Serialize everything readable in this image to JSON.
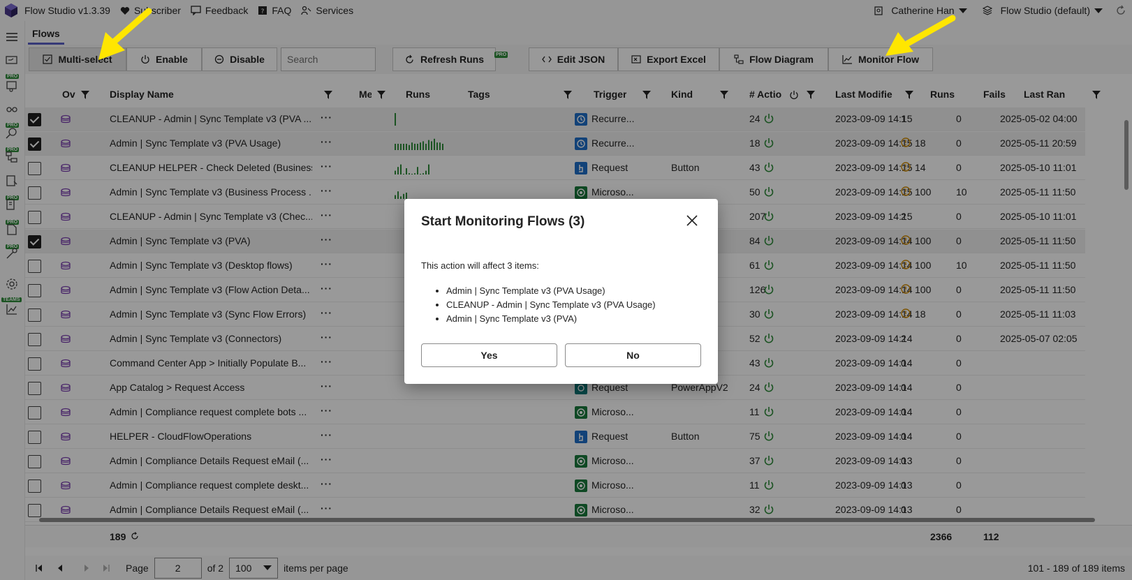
{
  "topbar": {
    "app_name": "Flow Studio v1.3.39",
    "links": [
      "Subscriber",
      "Feedback",
      "FAQ",
      "Services"
    ],
    "user": "Catherine Han",
    "environment": "Flow Studio (default)"
  },
  "tabs": [
    "Flows"
  ],
  "toolbar": {
    "multiselect": "Multi-select",
    "enable": "Enable",
    "disable": "Disable",
    "search_placeholder": "Search",
    "refresh": "Refresh Runs",
    "pro": "PRO",
    "edit_json": "Edit JSON",
    "export_excel": "Export Excel",
    "flow_diagram": "Flow Diagram",
    "monitor_flow": "Monitor Flow"
  },
  "rail": {
    "pro": "PRO",
    "teams": "TEAMS"
  },
  "columns": {
    "ov": "Ov",
    "display_name": "Display Name",
    "me": "Me",
    "runs": "Runs",
    "tags": "Tags",
    "trigger": "Trigger",
    "kind": "Kind",
    "actions": "# Actio",
    "last_modified": "Last Modifie",
    "runs2": "Runs",
    "fails": "Fails",
    "last_ran": "Last Ran"
  },
  "rows": [
    {
      "selected": true,
      "name": "CLEANUP - Admin | Sync Template v3 (PVA ...",
      "trigger": "Recurre...",
      "trigger_kind": "recurrence",
      "kind": "",
      "actions": "24",
      "modified": "2023-09-09 14:15",
      "runs": "1",
      "warn": false,
      "fails": "0",
      "last_ran": "2025-05-02 04:00",
      "spark": [
        1
      ]
    },
    {
      "selected": true,
      "name": "Admin | Sync Template v3 (PVA Usage)",
      "trigger": "Recurre...",
      "trigger_kind": "recurrence",
      "kind": "",
      "actions": "18",
      "modified": "2023-09-09 14:15",
      "runs": "18",
      "warn": true,
      "fails": "0",
      "last_ran": "2025-05-11 20:59",
      "spark": [
        0.5,
        0.5,
        0.5,
        0.5,
        0.5,
        0.4,
        0.6,
        0.5,
        0.5,
        0.6,
        0.7,
        0.5,
        0.8,
        0.7,
        0.9,
        0.6,
        0.6,
        0.5
      ]
    },
    {
      "selected": false,
      "name": "CLEANUP HELPER - Check Deleted (Business...",
      "trigger": "Request",
      "trigger_kind": "request",
      "kind": "Button",
      "actions": "43",
      "modified": "2023-09-09 14:15",
      "runs": "14",
      "warn": true,
      "fails": "0",
      "last_ran": "2025-05-10 11:01",
      "spark": [
        0.3,
        0.6,
        0.8,
        0,
        0.5,
        0.1,
        0,
        0.1,
        0.6,
        0,
        0.1,
        0.3,
        0.8
      ]
    },
    {
      "selected": false,
      "name": "Admin | Sync Template v3 (Business Process ...",
      "trigger": "Microso...",
      "trigger_kind": "microsoft",
      "kind": "",
      "actions": "50",
      "modified": "2023-09-09 14:15",
      "runs": "100",
      "warn": true,
      "fails": "10",
      "last_ran": "2025-05-11 11:50",
      "spark": [
        0.3,
        0.6,
        0.2,
        0.4,
        0.5
      ]
    },
    {
      "selected": false,
      "name": "CLEANUP - Admin | Sync Template v3 (Chec...",
      "trigger": "",
      "trigger_kind": "",
      "kind": "",
      "actions": "207",
      "modified": "2023-09-09 14:15",
      "runs": "2",
      "warn": false,
      "fails": "0",
      "last_ran": "2025-05-10 11:01",
      "spark": []
    },
    {
      "selected": true,
      "name": "Admin | Sync Template v3 (PVA)",
      "trigger": "",
      "trigger_kind": "",
      "kind": "",
      "actions": "84",
      "modified": "2023-09-09 14:14",
      "runs": "100",
      "warn": true,
      "fails": "0",
      "last_ran": "2025-05-11 11:50",
      "spark": []
    },
    {
      "selected": false,
      "name": "Admin | Sync Template v3 (Desktop flows)",
      "trigger": "",
      "trigger_kind": "",
      "kind": "",
      "actions": "61",
      "modified": "2023-09-09 14:14",
      "runs": "100",
      "warn": true,
      "fails": "10",
      "last_ran": "2025-05-11 11:50",
      "spark": []
    },
    {
      "selected": false,
      "name": "Admin | Sync Template v3 (Flow Action Deta...",
      "trigger": "",
      "trigger_kind": "",
      "kind": "",
      "actions": "126",
      "modified": "2023-09-09 14:14",
      "runs": "100",
      "warn": true,
      "fails": "0",
      "last_ran": "2025-05-11 11:50",
      "spark": []
    },
    {
      "selected": false,
      "name": "Admin | Sync Template v3 (Sync Flow Errors)",
      "trigger": "",
      "trigger_kind": "",
      "kind": "",
      "actions": "30",
      "modified": "2023-09-09 14:14",
      "runs": "18",
      "warn": true,
      "fails": "0",
      "last_ran": "2025-05-11 11:03",
      "spark": []
    },
    {
      "selected": false,
      "name": "Admin | Sync Template v3 (Connectors)",
      "trigger": "",
      "trigger_kind": "",
      "kind": "V2",
      "actions": "52",
      "modified": "2023-09-09 14:14",
      "runs": "2",
      "warn": false,
      "fails": "0",
      "last_ran": "2025-05-07 02:05",
      "spark": []
    },
    {
      "selected": false,
      "name": "Command Center App > Initially Populate B...",
      "trigger": "",
      "trigger_kind": "",
      "kind": "",
      "actions": "43",
      "modified": "2023-09-09 14:14",
      "runs": "0",
      "warn": false,
      "fails": "0",
      "last_ran": "",
      "spark": []
    },
    {
      "selected": false,
      "name": "App Catalog > Request Access",
      "trigger": "Request",
      "trigger_kind": "request-teal",
      "kind": "PowerAppV2",
      "actions": "24",
      "modified": "2023-09-09 14:14",
      "runs": "0",
      "warn": false,
      "fails": "0",
      "last_ran": "",
      "spark": []
    },
    {
      "selected": false,
      "name": "Admin | Compliance request complete bots ...",
      "trigger": "Microso...",
      "trigger_kind": "microsoft",
      "kind": "",
      "actions": "11",
      "modified": "2023-09-09 14:14",
      "runs": "0",
      "warn": false,
      "fails": "0",
      "last_ran": "",
      "spark": []
    },
    {
      "selected": false,
      "name": "HELPER - CloudFlowOperations",
      "trigger": "Request",
      "trigger_kind": "request",
      "kind": "Button",
      "actions": "75",
      "modified": "2023-09-09 14:14",
      "runs": "0",
      "warn": false,
      "fails": "0",
      "last_ran": "",
      "spark": []
    },
    {
      "selected": false,
      "name": "Admin | Compliance Details Request eMail (...",
      "trigger": "Microso...",
      "trigger_kind": "microsoft",
      "kind": "",
      "actions": "37",
      "modified": "2023-09-09 14:13",
      "runs": "0",
      "warn": false,
      "fails": "0",
      "last_ran": "",
      "spark": []
    },
    {
      "selected": false,
      "name": "Admin | Compliance request complete deskt...",
      "trigger": "Microso...",
      "trigger_kind": "microsoft",
      "kind": "",
      "actions": "11",
      "modified": "2023-09-09 14:13",
      "runs": "0",
      "warn": false,
      "fails": "0",
      "last_ran": "",
      "spark": []
    },
    {
      "selected": false,
      "name": "Admin | Compliance Details Request eMail (...",
      "trigger": "Microso...",
      "trigger_kind": "microsoft",
      "kind": "",
      "actions": "32",
      "modified": "2023-09-09 14:13",
      "runs": "0",
      "warn": false,
      "fails": "0",
      "last_ran": "",
      "spark": []
    }
  ],
  "summary": {
    "count": "189",
    "runs_total": "2366",
    "fails_total": "112"
  },
  "pager": {
    "page_label": "Page",
    "page": "2",
    "of": "of 2",
    "per_page": "100",
    "items_per_page": "items per page",
    "range": "101 - 189 of 189 items"
  },
  "dialog": {
    "title": "Start Monitoring Flows (3)",
    "body": "This action will affect 3 items:",
    "items": [
      "Admin | Sync Template v3 (PVA Usage)",
      "CLEANUP - Admin | Sync Template v3 (PVA Usage)",
      "Admin | Sync Template v3 (PVA)"
    ],
    "yes": "Yes",
    "no": "No"
  },
  "colors": {
    "accent": "#5b5fc7",
    "green": "#2e8b3a",
    "warn": "#d08a00",
    "arrow": "#ffe600"
  }
}
